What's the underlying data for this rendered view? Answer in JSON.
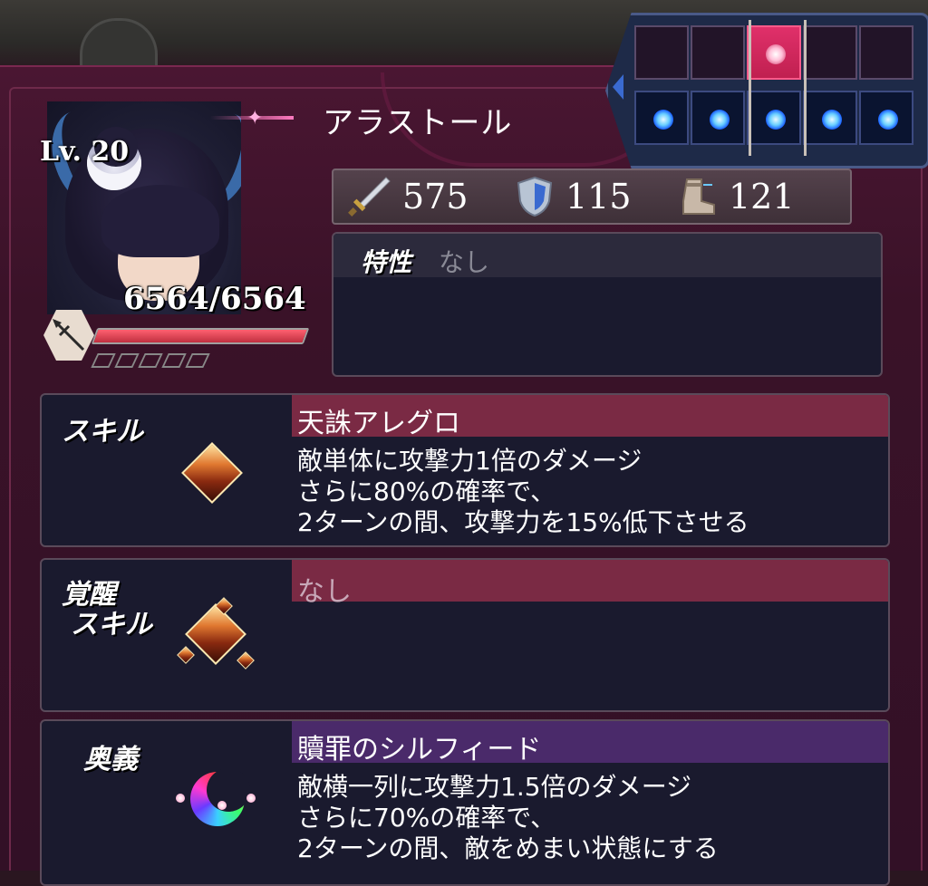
{
  "character": {
    "name": "アラストール",
    "level": "Lv. 20",
    "hp": "6564/6564",
    "hp_fraction": 1.0
  },
  "stats": {
    "attack": "575",
    "defense": "115",
    "speed": "121"
  },
  "trait": {
    "label": "特性",
    "value": "なし"
  },
  "skill": {
    "label": "スキル",
    "name": "天誅アレグロ",
    "desc": [
      "敵単体に攻撃力1倍のダメージ",
      "さらに80%の確率で、",
      "2ターンの間、攻撃力を15%低下させる"
    ],
    "header_color": "#7a2a44"
  },
  "awaken_skill": {
    "label_line1": "覚醒",
    "label_line2": "スキル",
    "name": "なし",
    "header_color": "#7a2a44"
  },
  "ultimate": {
    "label": "奥義",
    "name": "贖罪のシルフィード",
    "desc": [
      "敵横一列に攻撃力1.5倍のダメージ",
      "さらに70%の確率で、",
      "2ターンの間、敵をめまい状態にする"
    ],
    "header_color": "#4a2a6a"
  },
  "formation": {
    "front_row": [
      false,
      false,
      true,
      false,
      false
    ],
    "back_row": [
      true,
      true,
      true,
      true,
      true
    ]
  },
  "colors": {
    "accent_pink": "#e0306a",
    "accent_blue": "#1a60ff"
  },
  "icons": {
    "attack": "sword-icon",
    "defense": "shield-icon",
    "speed": "boot-icon",
    "weapon": "spear-icon",
    "skill": "orange-gem-icon",
    "awaken": "orange-gem-cluster-icon",
    "ultimate": "rainbow-moon-icon"
  }
}
